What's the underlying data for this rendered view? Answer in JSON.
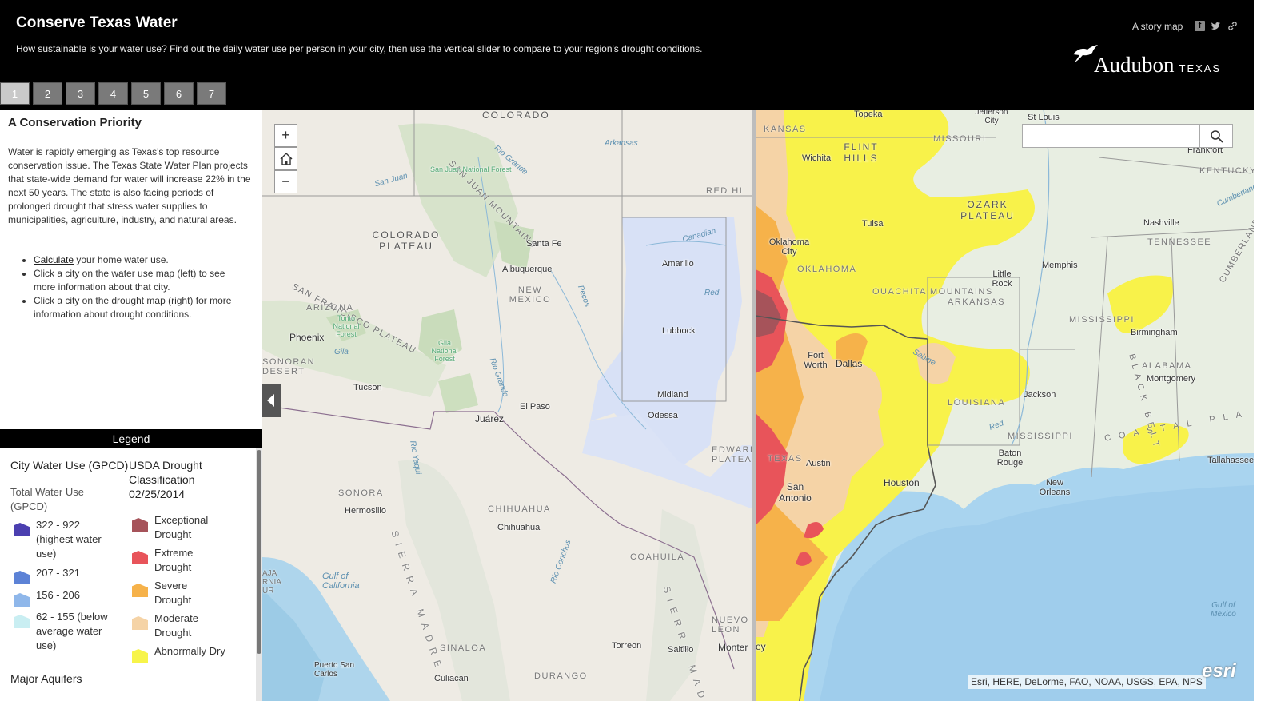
{
  "header": {
    "title": "Conserve Texas Water",
    "subtitle": "How sustainable is your water use? Find out the daily water use per person in your city, then use the vertical slider to compare to your region's drought conditions.",
    "story_label": "A story map",
    "logo_word": "Audubon",
    "logo_state": "TEXAS",
    "tabs": [
      "1",
      "2",
      "3",
      "4",
      "5",
      "6",
      "7"
    ],
    "active_tab": "1"
  },
  "side": {
    "section_title": "A Conservation Priority",
    "intro": "Water is rapidly emerging as Texas's top resource conservation issue. The Texas State Water Plan projects that state-wide demand for water will increase 22% in the next 50 years. The state is also facing periods of prolonged drought that stress water supplies to municipalities, agriculture, industry, and natural areas.",
    "bullets": [
      {
        "link": "Calculate",
        "text": " your home water use."
      },
      {
        "link": "",
        "text": "Click a city on the water use map (left) to see more information about that city."
      },
      {
        "link": "",
        "text": "Click a city on the drought map (right) for more information about drought conditions."
      }
    ]
  },
  "legend": {
    "heading": "Legend",
    "water": {
      "title": "City Water Use (GPCD)",
      "subtitle": "Total Water Use (GPCD)",
      "items": [
        {
          "label": "322 - 922 (highest water use)",
          "color": "#4b3fb0"
        },
        {
          "label": "207 - 321",
          "color": "#5c82d6"
        },
        {
          "label": "156 - 206",
          "color": "#8fb7ea"
        },
        {
          "label": "62 - 155 (below average water use)",
          "color": "#c9eef2"
        }
      ]
    },
    "drought": {
      "title": "USDA Drought Classification 02/25/2014",
      "items": [
        {
          "label": "Exceptional Drought",
          "color": "#a6535a"
        },
        {
          "label": "Extreme Drought",
          "color": "#e8545a"
        },
        {
          "label": "Severe Drought",
          "color": "#f6b24a"
        },
        {
          "label": "Moderate Drought",
          "color": "#f5d3a6"
        },
        {
          "label": "Abnormally Dry",
          "color": "#f7f44a"
        }
      ]
    },
    "aquifers_title": "Major Aquifers"
  },
  "map_left": {
    "labels": [
      "COLORADO",
      "Arkansas",
      "SAN JUAN MOUNTAINS",
      "San Juan National Forest",
      "Rio Grande",
      "San Juan",
      "RED HI",
      "COLORADO PLATEAU",
      "Santa Fe",
      "Albuquerque",
      "NEW MEXICO",
      "Amarillo",
      "Canadian",
      "Red",
      "Pecos",
      "SAN FRANCISCO PLATEAU",
      "ARIZONA",
      "Tonto National Forest",
      "Phoenix",
      "Gila",
      "Gila National Forest",
      "Lubbock",
      "SONORAN DESERT",
      "Tucson",
      "Rio Grande",
      "El Paso",
      "Juárez",
      "Midland",
      "Odessa",
      "EDWARD PLATEA",
      "SONORA",
      "Hermosillo",
      "SIERRA MADRE",
      "CHIHUAHUA",
      "Chihuahua",
      "Gulf of California",
      "Rio Yaqui",
      "Rio Conchos",
      "COAHUILA",
      "SIERRA MADRE",
      "NUEVO LEON",
      "Torreon",
      "Saltillo",
      "Monter",
      "SINALOA",
      "Puerto San Carlos",
      "Culiacan",
      "DURANGO",
      "AJA RNIA UR"
    ]
  },
  "map_right": {
    "labels": [
      "Topeka",
      "Jefferson City",
      "St Louis",
      "KANSAS",
      "MISSOURI",
      "Wichita",
      "FLINT HILLS",
      "Frankfort",
      "KENTUCKY",
      "OZARK PLATEAU",
      "Cumberland",
      "Tulsa",
      "Nashville",
      "TENNESSEE",
      "Oklahoma City",
      "OKLAHOMA",
      "Memphis",
      "Little Rock",
      "OUACHITA MOUNTAINS",
      "ARKANSAS",
      "CUMBERLAND",
      "MISSISSIPPI",
      "Birmingham",
      "Fort Worth",
      "Dallas",
      "Sabine",
      "ALABAMA",
      "Montgomery",
      "BLACK BELT",
      "LOUISIANA",
      "Jackson",
      "Red",
      "MISSISSIPPI",
      "TEXAS",
      "Austin",
      "Baton Rouge",
      "COASTAL PLA",
      "Tallahassee",
      "Houston",
      "New Orleans",
      "San Antonio",
      "Gulf of Mexico",
      "ey"
    ],
    "search_placeholder": "",
    "attribution": "Esri, HERE, DeLorme, FAO, NOAA, USGS, EPA, NPS",
    "esri": "esri"
  }
}
